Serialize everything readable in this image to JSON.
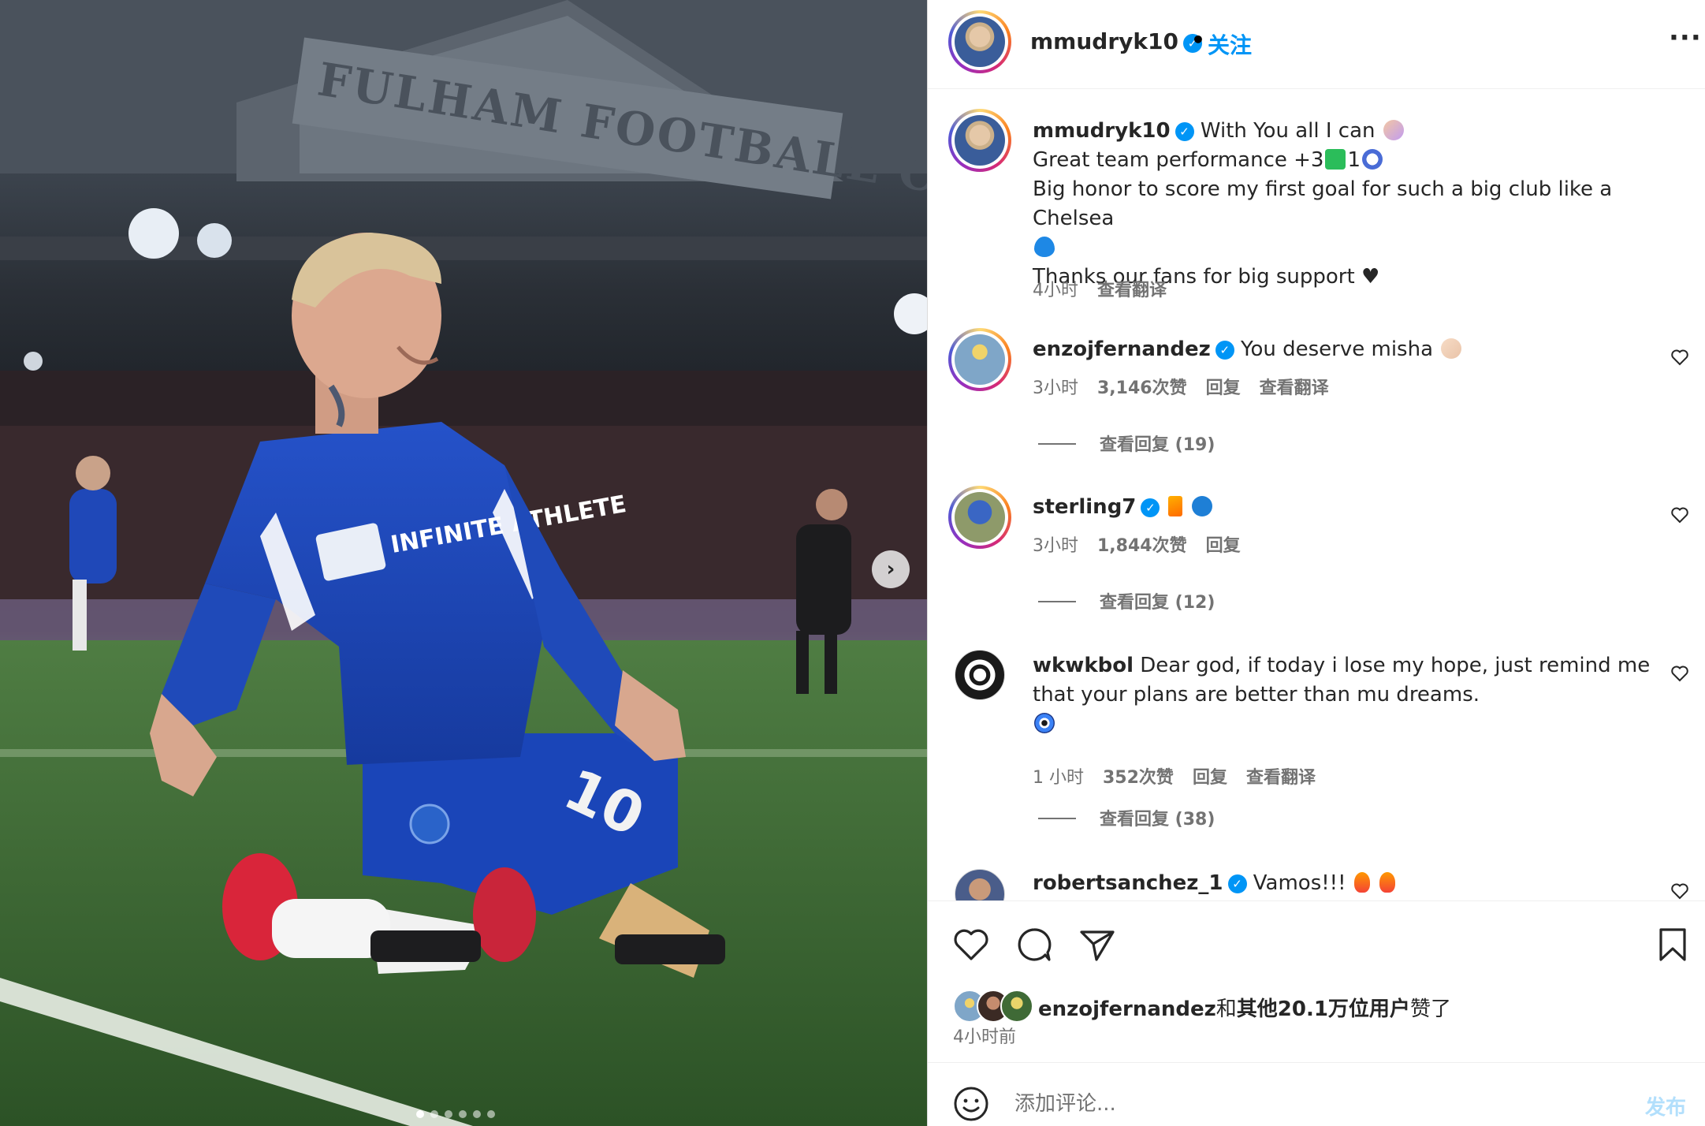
{
  "photo": {
    "stadium_sign": "FULHAM FOOTBALL CLUB",
    "shirt_sponsor": "INFINITE ATHLETE",
    "shirt_number": "10",
    "next_icon": "chevron-right-icon",
    "carousel": {
      "count": 6,
      "active": 1
    }
  },
  "header": {
    "username": "mmudryk10",
    "dot": "•",
    "follow_label": "关注",
    "more_icon": "more-horizontal-icon",
    "more_label": "···"
  },
  "caption": {
    "username": "mmudryk10",
    "line1": "With You all I can",
    "line2": "Great team performance +3",
    "line2b": "1",
    "line3": "Big honor to score my first goal for such a big club like a Chelsea",
    "line4": "Thanks our fans for big support ♥",
    "time": "4小时",
    "translate": "查看翻译"
  },
  "comments": [
    {
      "username": "enzojfernandez",
      "verified": true,
      "text": "You deserve misha",
      "time": "3小时",
      "likes": "3,146次赞",
      "reply": "回复",
      "translate": "查看翻译",
      "view_replies": "查看回复 (19)"
    },
    {
      "username": "sterling7",
      "verified": true,
      "text": "",
      "time": "3小时",
      "likes": "1,844次赞",
      "reply": "回复",
      "translate": "",
      "view_replies": "查看回复 (12)"
    },
    {
      "username": "wkwkbol",
      "verified": false,
      "text": "Dear god, if today i lose my hope, just remind me that your plans are better than mu dreams.",
      "time": "1 小时",
      "likes": "352次赞",
      "reply": "回复",
      "translate": "查看翻译",
      "view_replies": "查看回复 (38)"
    },
    {
      "username": "robertsanchez_1",
      "verified": true,
      "text": "Vamos!!!",
      "time": "",
      "likes": "",
      "reply": "",
      "translate": "",
      "view_replies": ""
    }
  ],
  "actions": {
    "like_icon": "heart-icon",
    "comment_icon": "comment-bubble-icon",
    "share_icon": "paper-plane-icon",
    "save_icon": "bookmark-icon",
    "likes_user": "enzojfernandez",
    "likes_and": "和",
    "likes_others": "其他20.1万位用户",
    "likes_suffix": "赞了",
    "post_time": "4小时前"
  },
  "add_comment": {
    "emoji_icon": "smiley-icon",
    "placeholder": "添加评论...",
    "publish_label": "发布"
  },
  "colors": {
    "accent": "#0095f6",
    "secondary_text": "#737373",
    "publish_disabled": "#b2dffc"
  }
}
